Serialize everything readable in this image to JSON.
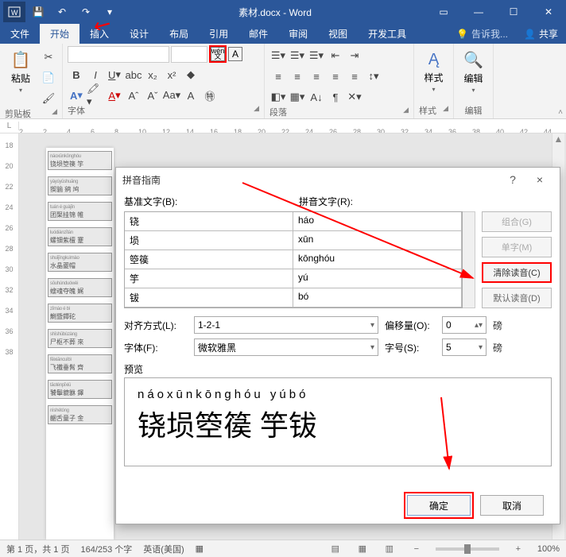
{
  "titlebar": {
    "title": "素材.docx - Word"
  },
  "tabs": {
    "file": "文件",
    "home": "开始",
    "insert": "插入",
    "design": "设计",
    "layout": "布局",
    "references": "引用",
    "mail": "邮件",
    "review": "审阅",
    "view": "视图",
    "dev": "开发工具",
    "tell": "告诉我...",
    "share": "共享"
  },
  "ribbon": {
    "clipboard": {
      "paste": "粘贴",
      "label": "剪贴板"
    },
    "font": {
      "label": "字体",
      "wen_top": "wén",
      "wen_bot": "文",
      "charA": "A"
    },
    "para": {
      "label": "段落"
    },
    "styles": {
      "label": "样式",
      "btn": "样式"
    },
    "edit": {
      "label": "编辑",
      "btn": "编辑"
    }
  },
  "ruler": {
    "L": "L",
    "marks": [
      "2",
      "2",
      "4",
      "6",
      "8",
      "10",
      "12",
      "14",
      "16",
      "18",
      "20",
      "22",
      "24",
      "26",
      "28",
      "30",
      "32",
      "34",
      "36",
      "38",
      "40",
      "42",
      "44"
    ],
    "vmarks": [
      "|18|",
      "|20|",
      "|22|",
      "|24|",
      "|26|",
      "|28|",
      "|30|",
      "|32|",
      "|34|",
      "|36|",
      "|38|"
    ]
  },
  "doc": {
    "rows": [
      {
        "py": "náoxūnkōnghóu",
        "han": "铙埙箜篌 竽"
      },
      {
        "py": "yàyúyūshuāng",
        "han": "猰貐 鹓 鸠"
      },
      {
        "py": "tuán é guàjĭn",
        "han": "团棸挂锦 帷"
      },
      {
        "py": "luódiànzĭtán",
        "han": "螺钿紫檀 蹇"
      },
      {
        "py": "shuĭjīngkuìmào",
        "han": "水晶夔帽  "
      },
      {
        "py": "sōuhúnduówèi",
        "han": "螋魂夺魄 娓"
      },
      {
        "py": "zĭmáo é bì",
        "han": "鰂暨鐔砣  "
      },
      {
        "py": "shīshūbùzàng",
        "han": "尸枢不葬 來"
      },
      {
        "py": "fēixiāncuìbì",
        "han": "飞襳垂髾 齊"
      },
      {
        "py": "tāoténpĭxiū",
        "han": "饕鬡貔貅 鐸"
      },
      {
        "py": "nìshétóng",
        "han": "齫舌童子 金"
      }
    ]
  },
  "dialog": {
    "title": "拼音指南",
    "help": "?",
    "close": "×",
    "labels": {
      "base": "基准文字(B):",
      "ruby": "拼音文字(R):",
      "align": "对齐方式(L):",
      "font": "字体(F):",
      "offset": "偏移量(O):",
      "size": "字号(S):",
      "pt": "磅",
      "preview": "预览"
    },
    "base": [
      "铙",
      "埙",
      "箜篌",
      "竽",
      "钹"
    ],
    "ruby": [
      "háo",
      "xūn",
      "kōnghóu",
      "yú",
      "bó"
    ],
    "side": {
      "combine": "组合(G)",
      "single": "单字(M)",
      "clear": "清除读音(C)",
      "default": "默认读音(D)"
    },
    "values": {
      "align": "1-2-1",
      "font": "微软雅黑",
      "offset": "0",
      "size": "5"
    },
    "preview": {
      "pinyin": "náoxūnkōnghóu  yúbó",
      "hanzi": "铙埙箜篌 竽钹"
    },
    "buttons": {
      "ok": "确定",
      "cancel": "取消"
    }
  },
  "status": {
    "page": "第 1 页，共 1 页",
    "words": "164/253 个字",
    "lang": "英语(美国)",
    "zoom": "100%"
  }
}
